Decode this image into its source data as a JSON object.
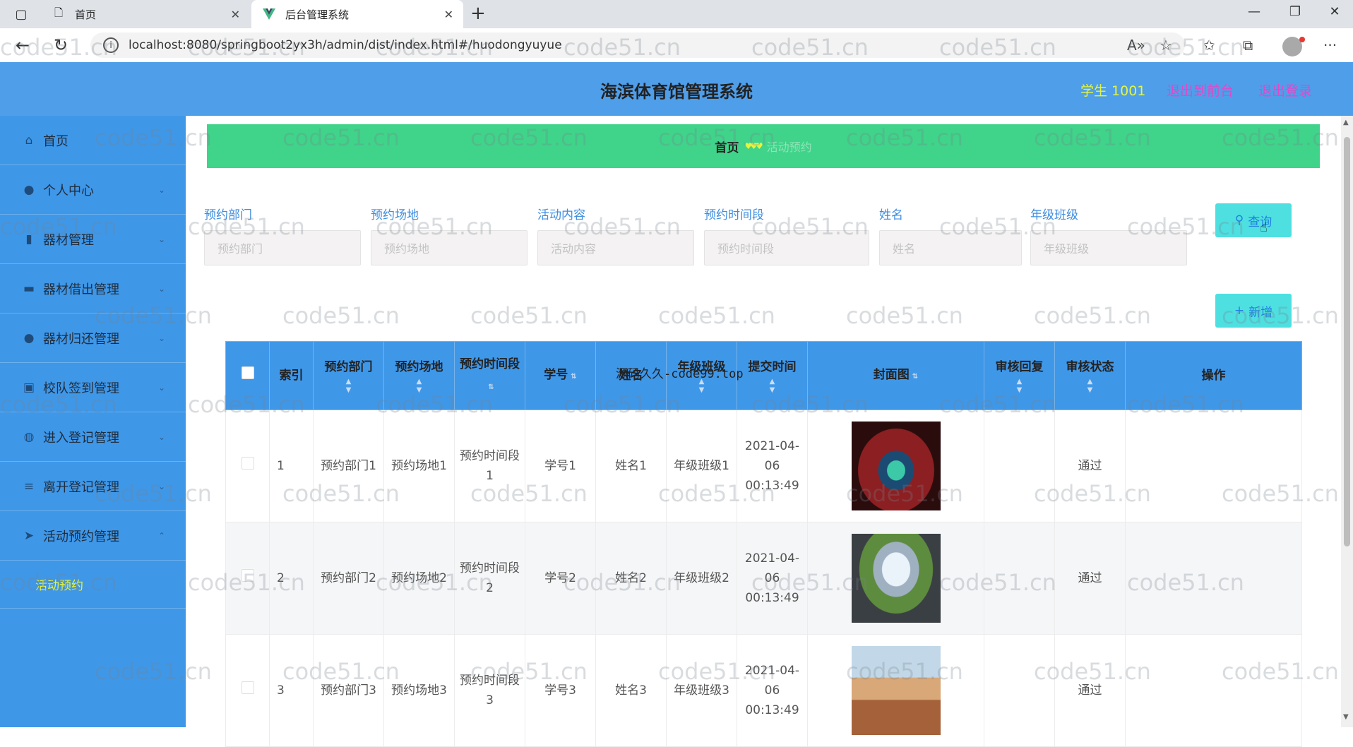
{
  "browser": {
    "tabs": [
      {
        "title": "首页",
        "icon": "page-icon"
      },
      {
        "title": "后台管理系统",
        "icon": "vue-logo-icon"
      }
    ],
    "new_tab": "+",
    "url": "localhost:8080/springboot2yx3h/admin/dist/index.html#/huodongyuyue",
    "toolbar_icons": [
      "read-aloud-icon",
      "favorite-star-icon",
      "favorites-icon",
      "collections-icon",
      "profile-avatar-icon",
      "more-icon"
    ]
  },
  "header": {
    "title": "海滨体育馆管理系统",
    "user": "学生 1001",
    "back_to_front": "退出到前台",
    "logout": "退出登录"
  },
  "sidebar": {
    "items": [
      {
        "label": "首页",
        "icon": "home-icon",
        "has_arrow": false
      },
      {
        "label": "个人中心",
        "icon": "person-icon",
        "has_arrow": true
      },
      {
        "label": "器材管理",
        "icon": "bar-chart-icon",
        "has_arrow": true
      },
      {
        "label": "器材借出管理",
        "icon": "monitor-icon",
        "has_arrow": true
      },
      {
        "label": "器材归还管理",
        "icon": "user-icon",
        "has_arrow": true
      },
      {
        "label": "校队签到管理",
        "icon": "clipboard-icon",
        "has_arrow": true
      },
      {
        "label": "进入登记管理",
        "icon": "globe-icon",
        "has_arrow": true
      },
      {
        "label": "离开登记管理",
        "icon": "list-icon",
        "has_arrow": true
      },
      {
        "label": "活动预约管理",
        "icon": "send-icon",
        "has_arrow": true,
        "expanded": true
      }
    ],
    "active_subitem": "活动预约"
  },
  "breadcrumb": {
    "home": "首页",
    "current": "活动预约"
  },
  "search": {
    "fields": [
      {
        "label": "预约部门",
        "placeholder": "预约部门"
      },
      {
        "label": "预约场地",
        "placeholder": "预约场地"
      },
      {
        "label": "活动内容",
        "placeholder": "活动内容"
      },
      {
        "label": "预约时间段",
        "placeholder": "预约时间段"
      },
      {
        "label": "姓名",
        "placeholder": "姓名"
      },
      {
        "label": "年级班级",
        "placeholder": "年级班级"
      }
    ],
    "query_button": "查询",
    "add_button": "新增"
  },
  "table": {
    "columns": [
      "索引",
      "预约部门",
      "预约场地",
      "预约时间段",
      "学号",
      "姓名",
      "年级班级",
      "提交时间",
      "封面图",
      "审核回复",
      "审核状态",
      "操作"
    ],
    "rows": [
      {
        "index": "1",
        "dept": "预约部门1",
        "venue": "预约场地1",
        "timeslot": "预约时间段1",
        "student_no": "学号1",
        "name": "姓名1",
        "grade_class": "年级班级1",
        "submit_time": "2021-04-06 00:13:49",
        "reply": "",
        "status": "通过"
      },
      {
        "index": "2",
        "dept": "预约部门2",
        "venue": "预约场地2",
        "timeslot": "预约时间段2",
        "student_no": "学号2",
        "name": "姓名2",
        "grade_class": "年级班级2",
        "submit_time": "2021-04-06 00:13:49",
        "reply": "",
        "status": "通过"
      },
      {
        "index": "3",
        "dept": "预约部门3",
        "venue": "预约场地3",
        "timeslot": "预约时间段3",
        "student_no": "学号3",
        "name": "姓名3",
        "grade_class": "年级班级3",
        "submit_time": "2021-04-06 00:13:49",
        "reply": "",
        "status": "通过"
      }
    ]
  },
  "watermark": {
    "text": "code51.cn",
    "center_text": "源码久久-code99.top"
  },
  "colors": {
    "header_bg": "#4f9ee9",
    "sidebar_bg": "#3f97e8",
    "breadcrumb_bg": "#3fd48a",
    "button_bg": "#4ee0e0",
    "accent_yellow": "#e5f53d",
    "accent_magenta": "#e546c9"
  }
}
